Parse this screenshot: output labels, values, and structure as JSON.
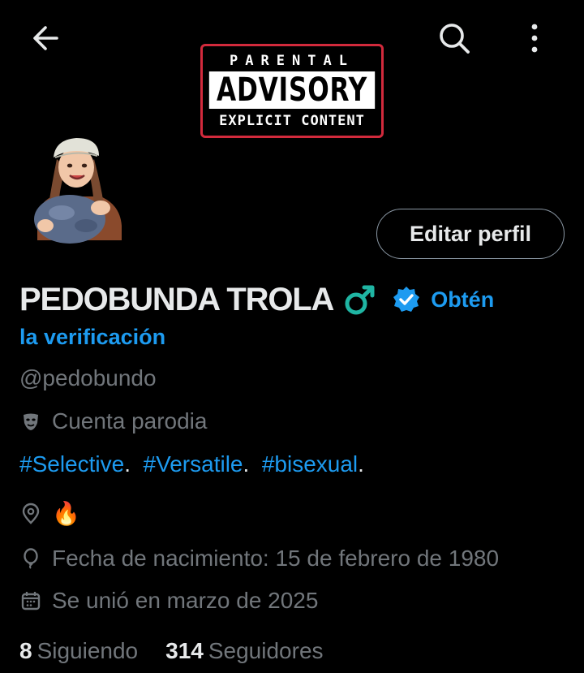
{
  "header": {
    "back_icon": "arrow-left-icon",
    "search_icon": "search-icon",
    "more_icon": "more-vertical-icon",
    "banner": {
      "line1": "PARENTAL",
      "line2": "ADVISORY",
      "line3": "EXPLICIT CONTENT",
      "border_color": "#d22a3c"
    }
  },
  "profile": {
    "display_name": "PEDOBUNDA TROLA",
    "gender_emoji": "♂",
    "verified_badge_color": "#1d9bf0",
    "verification_prompt_part1": "Obtén",
    "verification_prompt_part2": "la verificación",
    "handle": "@pedobundo",
    "parody_label": "Cuenta parodia",
    "hashtags": [
      "#Selective",
      "#Versatile",
      "#bisexual"
    ],
    "hashtag_separator": ".",
    "location": "🔥",
    "birth_date": "Fecha de nacimiento: 15 de febrero de 1980",
    "joined": "Se unió en marzo de 2025",
    "following_count": "8",
    "following_label": "Siguiendo",
    "followers_count": "314",
    "followers_label": "Seguidores"
  },
  "actions": {
    "edit_profile": "Editar perfil"
  },
  "colors": {
    "background": "#000000",
    "text_primary": "#e7e9ea",
    "text_secondary": "#71767b",
    "accent": "#1d9bf0",
    "male_sign": "#1fb5a3"
  }
}
